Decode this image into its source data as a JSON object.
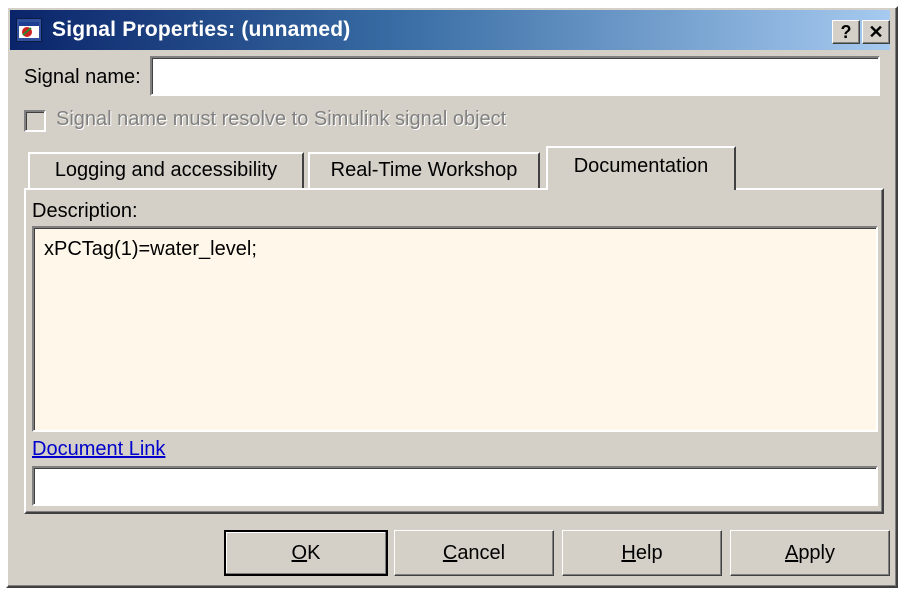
{
  "window": {
    "title": "Signal Properties: (unnamed)",
    "help_caption": "?",
    "close_caption": "✕"
  },
  "signal_name": {
    "label": "Signal name:",
    "value": ""
  },
  "resolve_checkbox": {
    "label": "Signal name must resolve to Simulink signal object",
    "checked": false,
    "enabled": false
  },
  "tabs": [
    {
      "label": "Logging and accessibility",
      "active": false
    },
    {
      "label": "Real-Time Workshop",
      "active": false
    },
    {
      "label": "Documentation",
      "active": true
    }
  ],
  "documentation": {
    "description_label": "Description:",
    "description_value": "xPCTag(1)=water_level;",
    "document_link_label": "Document Link",
    "document_link_value": ""
  },
  "buttons": {
    "ok": {
      "mnemonic": "O",
      "rest": "K"
    },
    "cancel": {
      "mnemonic": "C",
      "rest": "ancel"
    },
    "help": {
      "mnemonic": "H",
      "rest": "elp"
    },
    "apply": {
      "mnemonic": "A",
      "rest": "pply"
    }
  },
  "colors": {
    "dialog_face": "#d4d0c8",
    "title_gradient_start": "#0a246a",
    "title_gradient_end": "#a6caf0",
    "description_background": "#fff8ea",
    "link": "#0000cc"
  }
}
